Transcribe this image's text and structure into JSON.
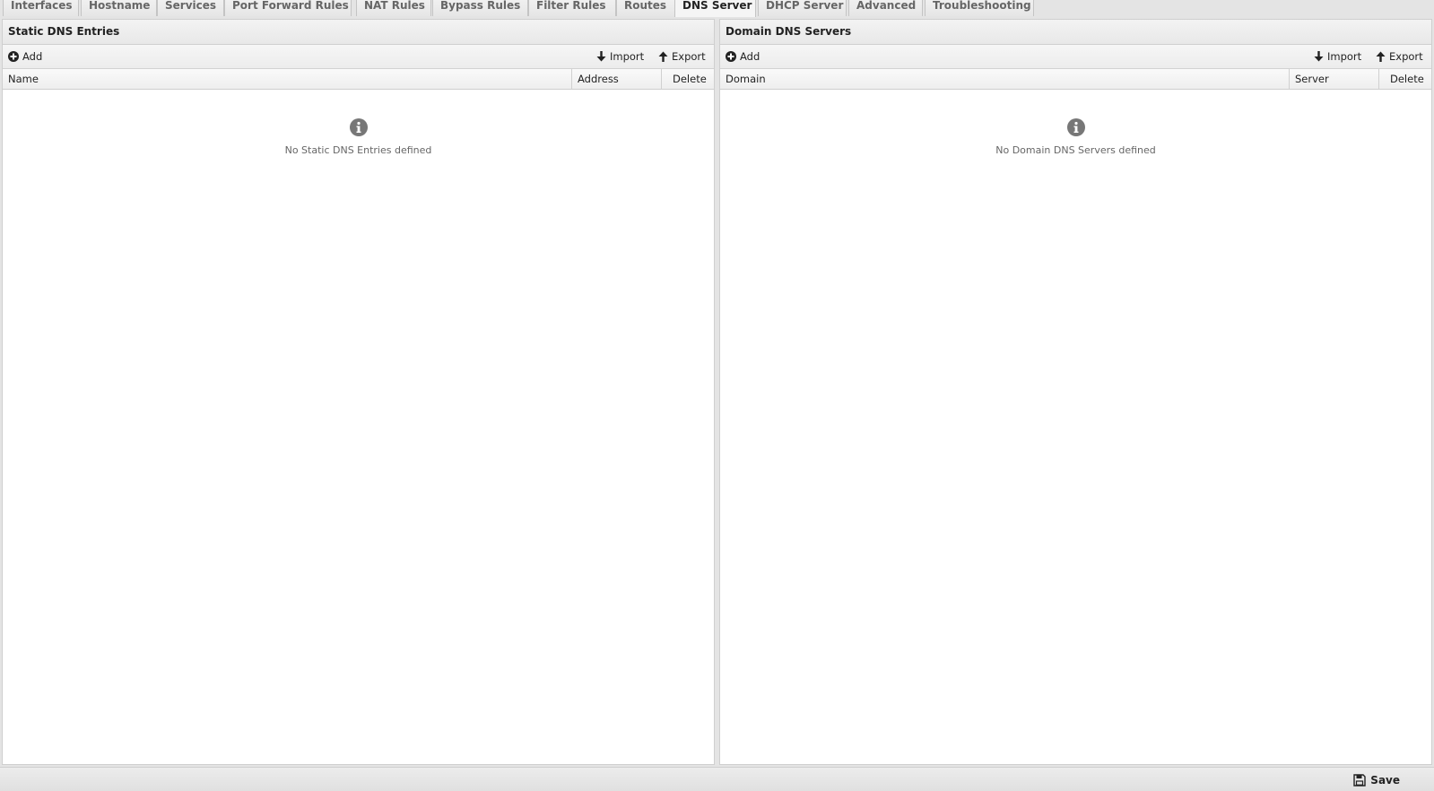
{
  "tabs": [
    {
      "label": "Interfaces",
      "active": false
    },
    {
      "label": "Hostname",
      "active": false
    },
    {
      "label": "Services",
      "active": false
    },
    {
      "label": "Port Forward Rules",
      "active": false
    },
    {
      "label": "NAT Rules",
      "active": false
    },
    {
      "label": "Bypass Rules",
      "active": false
    },
    {
      "label": "Filter Rules",
      "active": false
    },
    {
      "label": "Routes",
      "active": false
    },
    {
      "label": "DNS Server",
      "active": true
    },
    {
      "label": "DHCP Server",
      "active": false
    },
    {
      "label": "Advanced",
      "active": false
    },
    {
      "label": "Troubleshooting",
      "active": false
    }
  ],
  "static_dns": {
    "title": "Static DNS Entries",
    "add_label": "Add",
    "import_label": "Import",
    "export_label": "Export",
    "columns": [
      "Name",
      "Address",
      "Delete"
    ],
    "empty_message": "No Static DNS Entries defined",
    "icons": {
      "add": "plus-circle-icon",
      "import": "arrow-down-icon",
      "export": "arrow-up-icon",
      "empty": "info-icon"
    }
  },
  "domain_dns": {
    "title": "Domain DNS Servers",
    "add_label": "Add",
    "import_label": "Import",
    "export_label": "Export",
    "columns": [
      "Domain",
      "Server",
      "Delete"
    ],
    "empty_message": "No Domain DNS Servers defined",
    "icons": {
      "add": "plus-circle-icon",
      "import": "arrow-down-icon",
      "export": "arrow-up-icon",
      "empty": "info-icon"
    }
  },
  "footer": {
    "save_label": "Save",
    "save_icon": "floppy-disk-icon"
  }
}
